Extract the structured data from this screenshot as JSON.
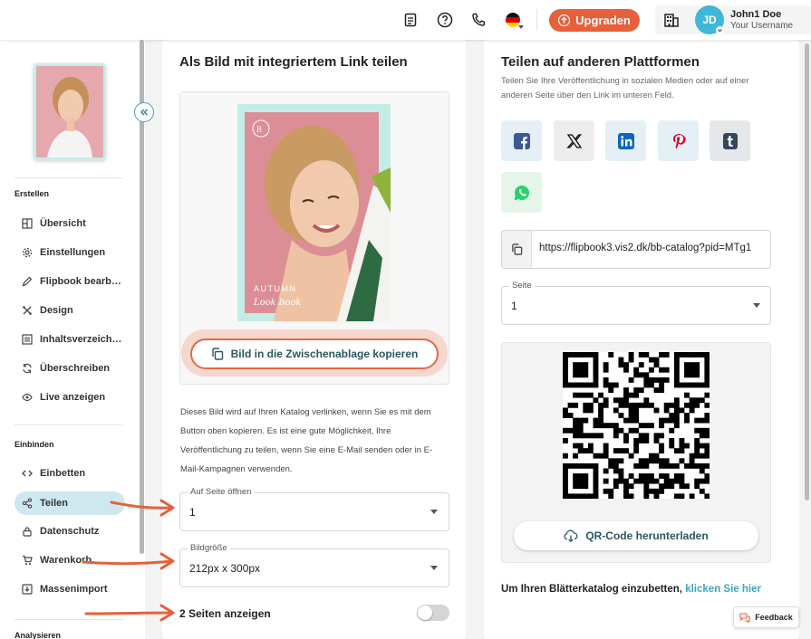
{
  "header": {
    "upgrade_label": "Upgraden",
    "avatar_initials": "JD",
    "user_name": "John1 Doe",
    "user_sub": "Your Username",
    "language_flag": "de-flag-icon"
  },
  "sidebar": {
    "section_create": "Erstellen",
    "section_embed": "Einbinden",
    "section_analyze": "Analysieren",
    "create_items": [
      {
        "label": "Übersicht",
        "icon": "overview-icon"
      },
      {
        "label": "Einstellungen",
        "icon": "gear-icon"
      },
      {
        "label": "Flipbook bearb…",
        "icon": "pencil-icon"
      },
      {
        "label": "Design",
        "icon": "palette-icon"
      },
      {
        "label": "Inhaltsverzeich…",
        "icon": "toc-icon"
      },
      {
        "label": "Überschreiben",
        "icon": "refresh-icon"
      },
      {
        "label": "Live anzeigen",
        "icon": "eye-icon"
      }
    ],
    "embed_items": [
      {
        "label": "Einbetten",
        "icon": "code-icon"
      },
      {
        "label": "Teilen",
        "icon": "share-icon",
        "active": true
      },
      {
        "label": "Datenschutz",
        "icon": "lock-icon"
      },
      {
        "label": "Warenkorb",
        "icon": "cart-icon"
      },
      {
        "label": "Massenimport",
        "icon": "import-icon"
      }
    ]
  },
  "left_panel": {
    "title": "Als Bild mit integriertem Link teilen",
    "cover_line1": "AUTUMN",
    "cover_line2": "Look book",
    "copy_button": "Bild in die Zwischenablage kopieren",
    "description": "Dieses Bild wird auf Ihren Katalog verlinken, wenn Sie es mit dem Button oben kopieren. Es ist eine gute Möglichkeit, Ihre Veröffentlichung zu teilen, wenn Sie eine E-Mail senden oder in E-Mail-Kampagnen verwenden.",
    "page_open_label": "Auf Seite öffnen",
    "page_open_value": "1",
    "size_label": "Bildgröße",
    "size_value": "212px x 300px",
    "two_pages_label": "2 Seiten anzeigen",
    "two_pages_on": false
  },
  "right_panel": {
    "title": "Teilen auf anderen Plattformen",
    "subtitle": "Teilen Sie Ihre Veröffentlichung in sozialen Medien oder auf einer anderen Seite über den Link im unteren Feld.",
    "social": [
      {
        "name": "facebook-icon",
        "color": "#1877f2",
        "bg": "#e4f0f5"
      },
      {
        "name": "x-icon",
        "color": "#111111",
        "bg": "#ededed"
      },
      {
        "name": "linkedin-icon",
        "color": "#0a66c2",
        "bg": "#e4f0f5"
      },
      {
        "name": "pinterest-icon",
        "color": "#e60023",
        "bg": "#e4f0f5"
      },
      {
        "name": "tumblr-icon",
        "color": "#36465d",
        "bg": "#e4e8ea"
      },
      {
        "name": "whatsapp-icon",
        "color": "#25d366",
        "bg": "#e6f5ea"
      }
    ],
    "url": "https://flipbook3.vis2.dk/bb-catalog?pid=MTg1",
    "page_label": "Seite",
    "page_value": "1",
    "qr_button": "QR-Code herunterladen",
    "embed_text": "Um Ihren Blätterkatalog einzubetten,",
    "embed_link": "klicken Sie hier"
  },
  "feedback_label": "Feedback",
  "colors": {
    "accent": "#e5603b",
    "teal": "#3aa7bf",
    "active_bg": "#cde8ef"
  }
}
